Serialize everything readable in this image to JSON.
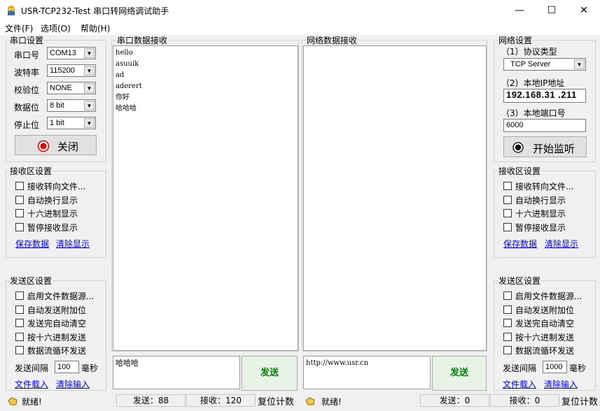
{
  "window": {
    "title": "USR-TCP232-Test 串口转网络调试助手",
    "min_glyph": "—",
    "max_glyph": "☐",
    "close_glyph": "✕"
  },
  "menu": [
    "文件(F)",
    "选项(O)",
    "帮助(H)"
  ],
  "serial_settings": {
    "title": "串口设置",
    "port_label": "串口号",
    "port_value": "COM13",
    "baud_label": "波特率",
    "baud_value": "115200",
    "parity_label": "校验位",
    "parity_value": "NONE",
    "databits_label": "数据位",
    "databits_value": "8 bit",
    "stopbits_label": "停止位",
    "stopbits_value": "1 bit",
    "close_button": "关闭"
  },
  "left_receive_settings": {
    "title": "接收区设置",
    "options": [
      "接收转向文件...",
      "自动换行显示",
      "十六进制显示",
      "暂停接收显示"
    ],
    "save_link": "保存数据",
    "clear_link": "清除显示"
  },
  "left_send_settings": {
    "title": "发送区设置",
    "options": [
      "启用文件数据源...",
      "自动发送附加位",
      "发送完自动清空",
      "按十六进制发送",
      "数据流循环发送"
    ],
    "interval_label": "发送间隔",
    "interval_value": "100",
    "interval_unit": "毫秒",
    "load_link": "文件载入",
    "clear_link": "清除输入"
  },
  "serial_receive": {
    "title": "串口数据接收",
    "lines": [
      "hello",
      "asuuik",
      "ad",
      "aderert",
      "你好",
      "哈哈哈"
    ]
  },
  "network_receive": {
    "title": "网络数据接收"
  },
  "serial_send": {
    "text": "哈哈哈",
    "button": "发送"
  },
  "network_send": {
    "text": "http://www.usr.cn",
    "button": "发送"
  },
  "network_settings": {
    "title": "网络设置",
    "protocol_label": "（1）协议类型",
    "protocol_value": "TCP Server",
    "ip_label": "（2）本地IP地址",
    "ip_value": "192.168.31 .211",
    "port_label": "（3）本地端口号",
    "port_value": "6000",
    "listen_button": "开始监听"
  },
  "right_receive_settings": {
    "title": "接收区设置",
    "options": [
      "接收转向文件...",
      "自动换行显示",
      "十六进制显示",
      "暂停接收显示"
    ],
    "save_link": "保存数据",
    "clear_link": "清除显示"
  },
  "right_send_settings": {
    "title": "发送区设置",
    "options": [
      "启用文件数据源...",
      "自动发送附加位",
      "发送完自动清空",
      "按十六进制发送",
      "数据流循环发送"
    ],
    "interval_label": "发送间隔",
    "interval_value": "1000",
    "interval_unit": "毫秒",
    "load_link": "文件载入",
    "clear_link": "清除输入"
  },
  "status_left": {
    "ready": "就绪!",
    "sent": "发送：88",
    "received": "接收：120",
    "reset": "复位计数"
  },
  "status_right": {
    "ready": "就绪!",
    "sent": "发送：0",
    "received": "接收：0",
    "reset": "复位计数"
  },
  "colors": {
    "link": "#0000ee",
    "send_text": "#008000",
    "record_icon": "#e00000"
  }
}
